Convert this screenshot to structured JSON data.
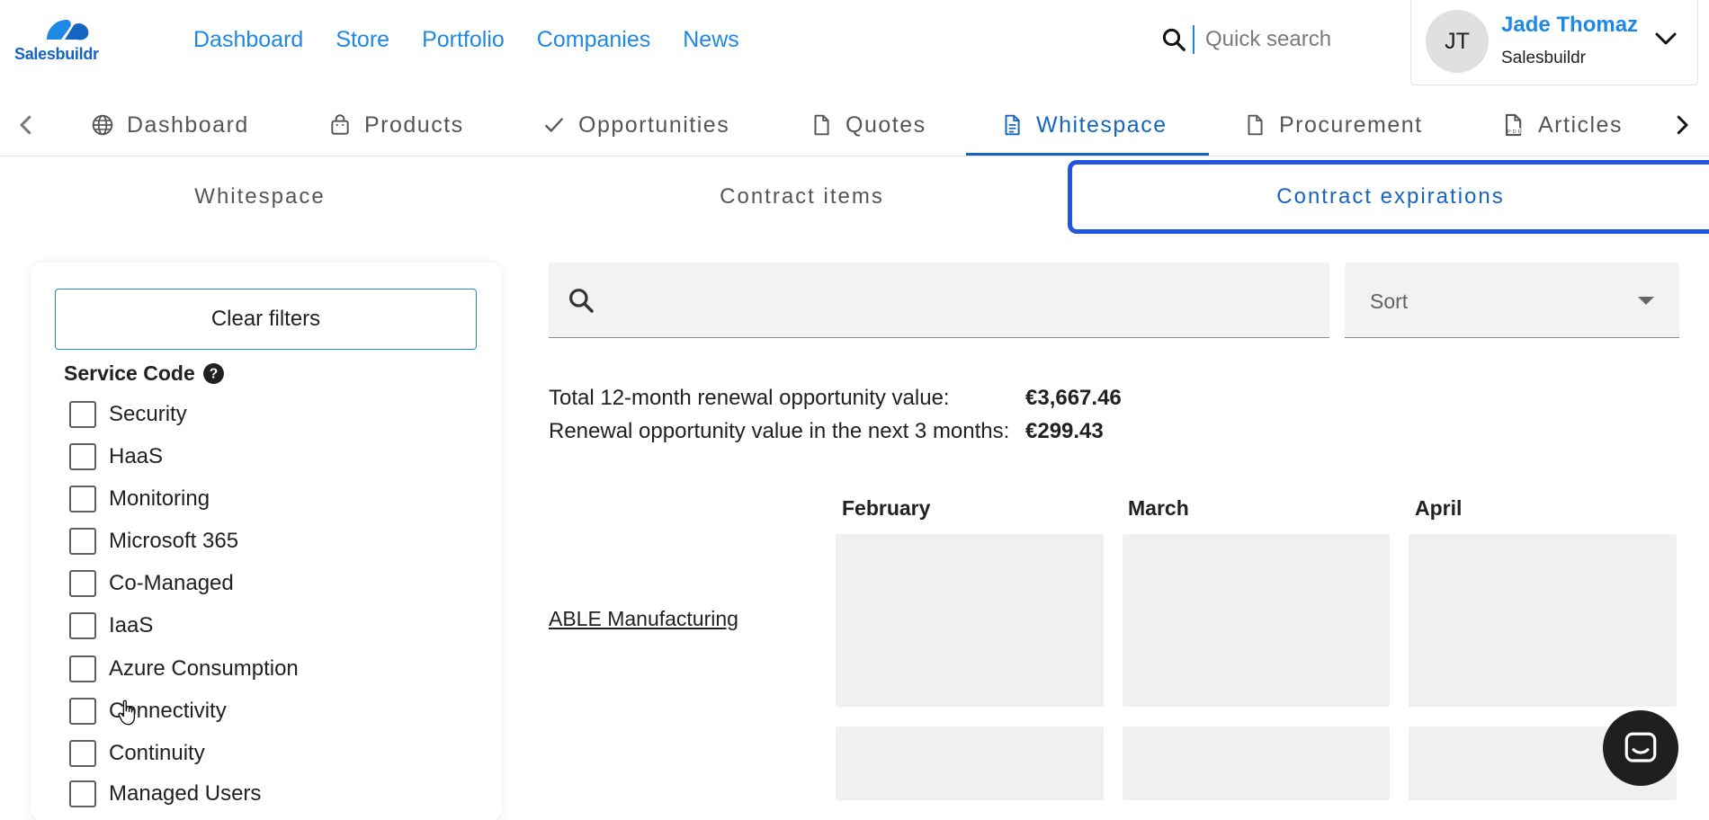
{
  "header": {
    "logo_text": "Salesbuildr",
    "nav": [
      "Dashboard",
      "Store",
      "Portfolio",
      "Companies",
      "News"
    ],
    "search_placeholder": "Quick search",
    "user": {
      "initials": "JT",
      "name": "Jade Thomaz",
      "company": "Salesbuildr"
    }
  },
  "tabs": {
    "items": [
      {
        "label": "Dashboard",
        "icon": "globe-icon"
      },
      {
        "label": "Products",
        "icon": "shopping-bag-icon"
      },
      {
        "label": "Opportunities",
        "icon": "check-icon"
      },
      {
        "label": "Quotes",
        "icon": "document-icon"
      },
      {
        "label": "Whitespace",
        "icon": "document-lines-icon",
        "active": true
      },
      {
        "label": "Procurement",
        "icon": "document-icon"
      },
      {
        "label": "Articles",
        "icon": "pdf-icon"
      }
    ]
  },
  "subtabs": {
    "items": [
      "Whitespace",
      "Contract items",
      "Contract expirations"
    ],
    "active": "Contract expirations"
  },
  "filters": {
    "clear_label": "Clear filters",
    "title": "Service Code",
    "options": [
      "Security",
      "HaaS",
      "Monitoring",
      "Microsoft 365",
      "Co-Managed",
      "IaaS",
      "Azure Consumption",
      "Connectivity",
      "Continuity",
      "Managed Users"
    ]
  },
  "main": {
    "search_value": "",
    "sort_label": "Sort",
    "summary": [
      {
        "label": "Total 12-month renewal opportunity value:",
        "value": "€3,667.46"
      },
      {
        "label": "Renewal opportunity value in the next 3 months:",
        "value": "€299.43"
      }
    ],
    "months": [
      "February",
      "March",
      "April"
    ],
    "companies": [
      "ABLE Manufacturing"
    ]
  },
  "colors": {
    "brand_blue": "#1e88e5",
    "active_tab": "#1565c0",
    "focus_outline": "#2255e0"
  }
}
